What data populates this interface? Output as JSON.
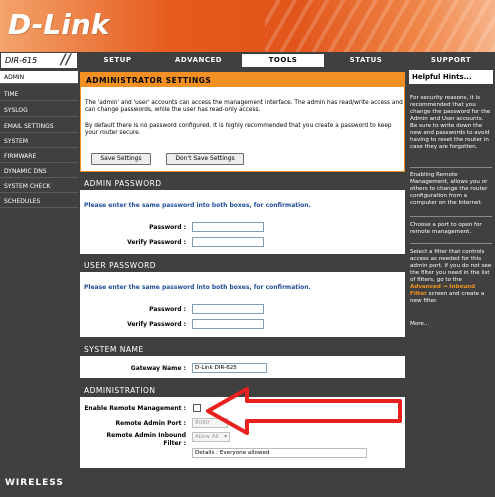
{
  "brand": {
    "logo_text": "D-Link",
    "model": "DIR-615"
  },
  "top_tabs": [
    "SETUP",
    "ADVANCED",
    "TOOLS",
    "STATUS",
    "SUPPORT"
  ],
  "active_tab": "TOOLS",
  "sidebar": {
    "items": [
      "ADMIN",
      "TIME",
      "SYSLOG",
      "EMAIL SETTINGS",
      "SYSTEM",
      "FIRMWARE",
      "DYNAMIC DNS",
      "SYSTEM CHECK",
      "SCHEDULES"
    ],
    "active": "ADMIN"
  },
  "admin_settings": {
    "title": "ADMINISTRATOR SETTINGS",
    "para1": "The 'admin' and 'user' accounts can access the management interface. The admin has read/write access and can change passwords, while the user has read-only access.",
    "para2": "By default there is no password configured. It is highly recommended that you create a password to keep your router secure.",
    "save_label": "Save Settings",
    "dont_save_label": "Don't Save Settings"
  },
  "admin_password": {
    "title": "ADMIN PASSWORD",
    "note": "Please enter the same password into both boxes, for confirmation.",
    "password_label": "Password :",
    "verify_label": "Verify Password :",
    "password_value": "",
    "verify_value": ""
  },
  "user_password": {
    "title": "USER PASSWORD",
    "note": "Please enter the same password into both boxes, for confirmation.",
    "password_label": "Password :",
    "verify_label": "Verify Password :",
    "password_value": "",
    "verify_value": ""
  },
  "system_name": {
    "title": "SYSTEM NAME",
    "gateway_label": "Gateway Name :",
    "gateway_value": "D-Link DIR-625"
  },
  "administration": {
    "title": "ADMINISTRATION",
    "remote_mgmt_label": "Enable Remote Management :",
    "remote_mgmt_checked": false,
    "port_label": "Remote Admin Port :",
    "port_value": "8080",
    "inbound_label_1": "Remote Admin Inbound",
    "inbound_label_2": "Filter :",
    "inbound_value": "Allow All",
    "details_value": "Details : Everyone allowed"
  },
  "hints": {
    "title": "Helpful Hints...",
    "p1": "For security reasons, it is recommended that you change the password for the Admin and User accounts. Be sure to write down the new and passwords to avoid having to reset the router in case they are forgotten.",
    "p2": "Enabling Remote Management, allows you or others to change the router configuration from a computer on the Internet.",
    "p3": "Choose a port to open for remote management.",
    "p4": "Select a filter that controls access as needed for this admin port. If you do not see the filter you need in the list of filters, go to the",
    "p4_link_1": "Advanced →",
    "p4_link_2": "Inbound Filter",
    "p4_tail": "screen and create a new filter.",
    "more": "More..."
  },
  "footer": {
    "text": "WIRELESS"
  },
  "colors": {
    "orange": "#f29024",
    "dark": "#404040",
    "annotation_red": "#e8201e",
    "note_blue": "#1f4e9a"
  }
}
